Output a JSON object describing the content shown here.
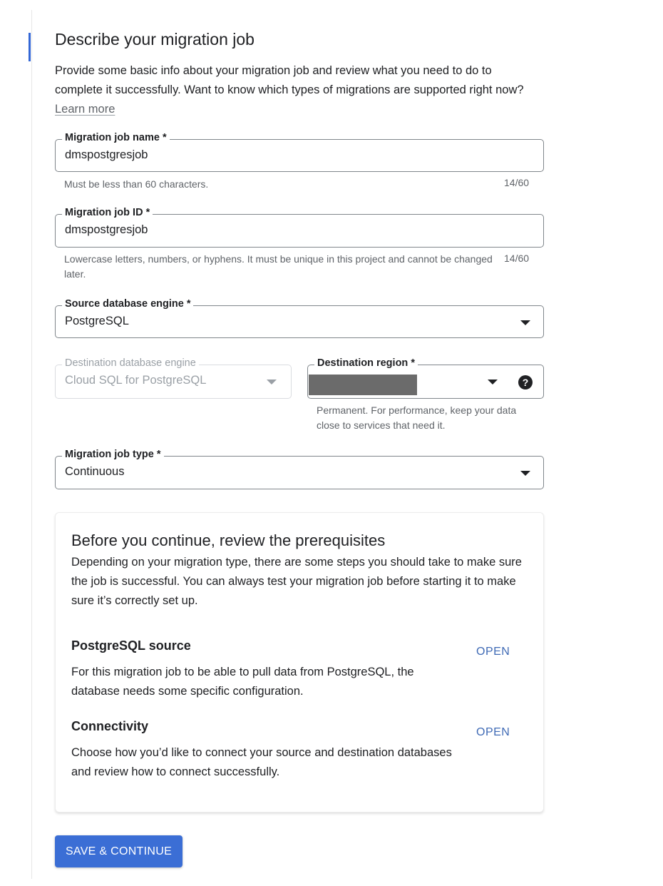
{
  "section": {
    "title": "Describe your migration job",
    "intro": "Provide some basic info about your migration job and review what you need to do to complete it successfully. Want to know which types of migrations are supported right now?",
    "learn_more": "Learn more"
  },
  "fields": {
    "job_name": {
      "label": "Migration job name *",
      "value": "dmspostgresjob",
      "hint": "Must be less than 60 characters.",
      "counter": "14/60"
    },
    "job_id": {
      "label": "Migration job ID *",
      "value": "dmspostgresjob",
      "hint": "Lowercase letters, numbers, or hyphens. It must be unique in this project and cannot be changed later.",
      "counter": "14/60"
    },
    "source_engine": {
      "label": "Source database engine *",
      "value": "PostgreSQL"
    },
    "destination_engine": {
      "label": "Destination database engine",
      "value": "Cloud SQL for PostgreSQL"
    },
    "destination_region": {
      "label": "Destination region *",
      "hint": "Permanent. For performance, keep your data close to services that need it."
    },
    "job_type": {
      "label": "Migration job type *",
      "value": "Continuous"
    }
  },
  "prerequisites": {
    "title": "Before you continue, review the prerequisites",
    "description": "Depending on your migration type, there are some steps you should take to make sure the job is successful. You can always test your migration job before starting it to make sure it’s correctly set up.",
    "items": [
      {
        "title": "PostgreSQL source",
        "description": "For this migration job to be able to pull data from PostgreSQL, the database needs some specific configuration.",
        "action": "OPEN"
      },
      {
        "title": "Connectivity",
        "description": "Choose how you’d like to connect your source and destination databases and review how to connect successfully.",
        "action": "OPEN"
      }
    ]
  },
  "actions": {
    "save_continue": "SAVE & CONTINUE"
  },
  "icons": {
    "dropdown": "caret-down-icon",
    "help": "help-circle-icon"
  },
  "colors": {
    "accent": "#3b6ed5",
    "link": "#3f6ab5"
  }
}
